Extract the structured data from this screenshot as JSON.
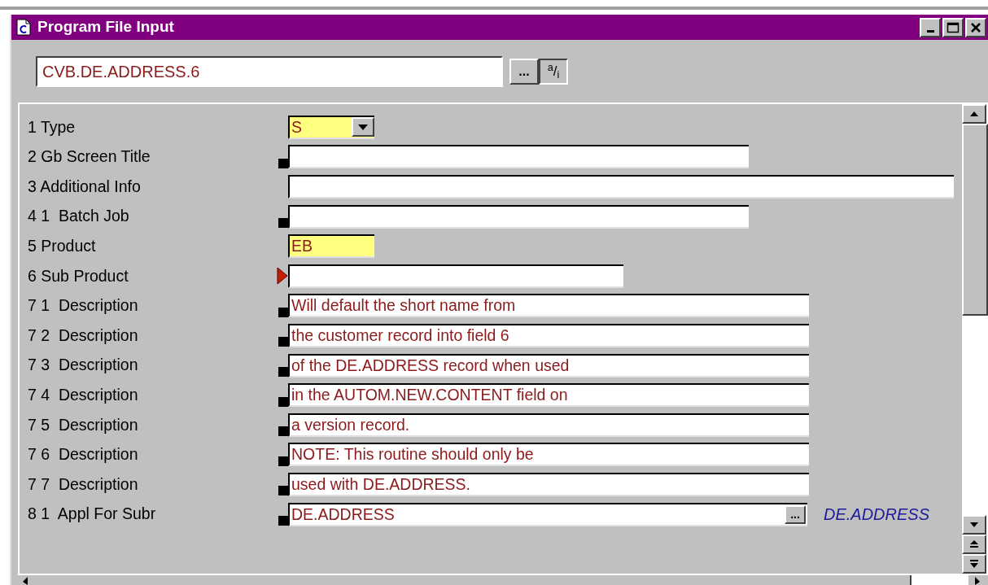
{
  "window": {
    "title": "Program File Input"
  },
  "record": {
    "value": "CVB.DE.ADDRESS.6",
    "lookup_button": "...",
    "toggle_button": "$^{a}$/$_{i}$"
  },
  "fields": [
    {
      "label": "1 Type",
      "kind": "combo",
      "value": "S",
      "highlight": true,
      "mandatory": false,
      "current": false
    },
    {
      "label": "2 Gb Screen Title",
      "kind": "text",
      "highlight": false,
      "mandatory": true,
      "current": false
    },
    {
      "label": "3 Additional Info",
      "kind": "text",
      "highlight": false,
      "mandatory": false,
      "current": false
    },
    {
      "label": "4 1  Batch Job",
      "kind": "text",
      "highlight": false,
      "mandatory": true,
      "current": false
    },
    {
      "label": "5 Product",
      "kind": "text",
      "value": "EB",
      "highlight": true,
      "mandatory": false,
      "current": false
    },
    {
      "label": "6 Sub Product",
      "kind": "text",
      "highlight": false,
      "mandatory": false,
      "current": true
    },
    {
      "label": "7 1  Description",
      "kind": "text",
      "value": "Will default the short name from",
      "highlight": false,
      "mandatory": true,
      "current": false
    },
    {
      "label": "7 2  Description",
      "kind": "text",
      "value": "the customer record into field 6",
      "highlight": false,
      "mandatory": true,
      "current": false
    },
    {
      "label": "7 3  Description",
      "kind": "text",
      "value": "of the DE.ADDRESS record when used",
      "highlight": false,
      "mandatory": true,
      "current": false
    },
    {
      "label": "7 4  Description",
      "kind": "text",
      "value": "in the AUTOM.NEW.CONTENT field on",
      "highlight": false,
      "mandatory": true,
      "current": false
    },
    {
      "label": "7 5  Description",
      "kind": "text",
      "value": "a version record.",
      "highlight": false,
      "mandatory": true,
      "current": false
    },
    {
      "label": "7 6  Description",
      "kind": "text",
      "value": "NOTE: This routine should only be",
      "highlight": false,
      "mandatory": true,
      "current": false
    },
    {
      "label": "7 7  Description",
      "kind": "text",
      "value": "used with DE.ADDRESS.",
      "highlight": false,
      "mandatory": true,
      "current": false
    },
    {
      "label": "8 1  Appl For Subr",
      "kind": "lookup",
      "value": "DE.ADDRESS",
      "highlight": false,
      "mandatory": true,
      "current": false,
      "button": "...",
      "enrichment": "DE.ADDRESS"
    }
  ]
}
